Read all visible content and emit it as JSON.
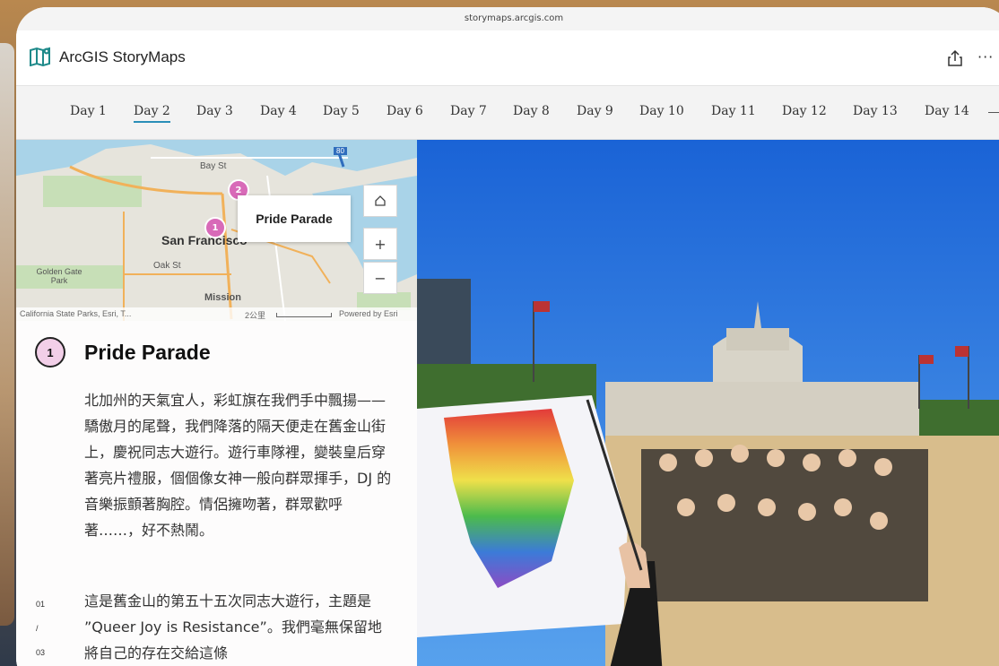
{
  "browser": {
    "url": "storymaps.arcgis.com"
  },
  "app": {
    "title": "ArcGIS StoryMaps",
    "more_label": "···"
  },
  "nav": {
    "days": [
      "Day 1",
      "Day 2",
      "Day 3",
      "Day 4",
      "Day 5",
      "Day 6",
      "Day 7",
      "Day 8",
      "Day 9",
      "Day 10",
      "Day 11",
      "Day 12",
      "Day 13",
      "Day 14"
    ],
    "active_index": 1
  },
  "map": {
    "popup_title": "Pride Parade",
    "labels": {
      "city": "San Francisco",
      "bay_st": "Bay St",
      "oak_st": "Oak St",
      "golden_gate": "Golden Gate Park",
      "mission": "Mission",
      "highway": "80"
    },
    "markers": [
      "1",
      "2"
    ],
    "zoom_in": "+",
    "zoom_out": "−",
    "attribution": "California State Parks, Esri, T...",
    "scale": "2公里",
    "powered_by": "Powered by Esri"
  },
  "section": {
    "number": "1",
    "title": "Pride Parade",
    "paragraph1": "北加州的天氣宜人，彩虹旗在我們手中飄揚——驕傲月的尾聲，我們降落的隔天便走在舊金山街上，慶祝同志大遊行。遊行車隊裡，變裝皇后穿著亮片禮服，個個像女神一般向群眾揮手，DJ 的音樂振顫著胸腔。情侶擁吻著，群眾歡呼著……，好不熱鬧。",
    "paragraph2": "這是舊金山的第五十五次同志大遊行，主題是 ”Queer Joy is Resistance”。我們毫無保留地將自己的存在交給這條",
    "notes": [
      "01",
      "/",
      "03"
    ]
  },
  "colors": {
    "accent": "#2a8fb8",
    "marker": "#d86ab8",
    "marker_badge": "#f2cfe8"
  },
  "icons": [
    "map-book-icon",
    "share-icon",
    "home-icon"
  ]
}
